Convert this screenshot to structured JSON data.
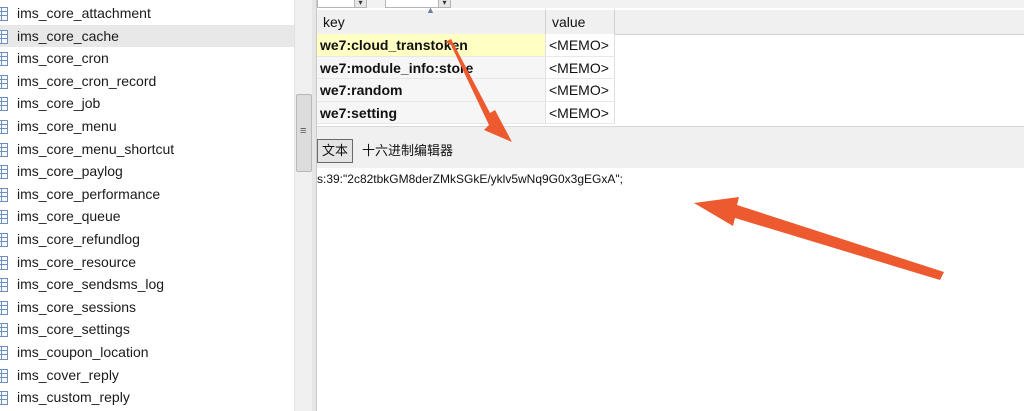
{
  "sidebar": {
    "tables": [
      {
        "label": "ims_core_attachment",
        "selected": false
      },
      {
        "label": "ims_core_cache",
        "selected": true
      },
      {
        "label": "ims_core_cron",
        "selected": false
      },
      {
        "label": "ims_core_cron_record",
        "selected": false
      },
      {
        "label": "ims_core_job",
        "selected": false
      },
      {
        "label": "ims_core_menu",
        "selected": false
      },
      {
        "label": "ims_core_menu_shortcut",
        "selected": false
      },
      {
        "label": "ims_core_paylog",
        "selected": false
      },
      {
        "label": "ims_core_performance",
        "selected": false
      },
      {
        "label": "ims_core_queue",
        "selected": false
      },
      {
        "label": "ims_core_refundlog",
        "selected": false
      },
      {
        "label": "ims_core_resource",
        "selected": false
      },
      {
        "label": "ims_core_sendsms_log",
        "selected": false
      },
      {
        "label": "ims_core_sessions",
        "selected": false
      },
      {
        "label": "ims_core_settings",
        "selected": false
      },
      {
        "label": "ims_coupon_location",
        "selected": false
      },
      {
        "label": "ims_cover_reply",
        "selected": false
      },
      {
        "label": "ims_custom_reply",
        "selected": false
      }
    ]
  },
  "scrollbar": {
    "grip": "≡"
  },
  "grid": {
    "columns": {
      "key": "key",
      "value": "value"
    },
    "sort_indicator": "▲",
    "rows": [
      {
        "key": "we7:cloud_transtoken",
        "value": "<MEMO>",
        "current": true
      },
      {
        "key": "we7:module_info:store",
        "value": "<MEMO>",
        "current": false
      },
      {
        "key": "we7:random",
        "value": "<MEMO>",
        "current": false
      },
      {
        "key": "we7:setting",
        "value": "<MEMO>",
        "current": false
      }
    ]
  },
  "editor": {
    "tab_text": "文本",
    "tab_hex": "十六进制编辑器",
    "content": "s:39:\"2c82tbkGM8derZMkSGkE/yklv5wNq9G0x3gEGxA\";"
  },
  "colors": {
    "arrow": "#ee5a2f",
    "selected_row": "#ffffc4",
    "selected_sidebar": "#e8e8e8"
  }
}
